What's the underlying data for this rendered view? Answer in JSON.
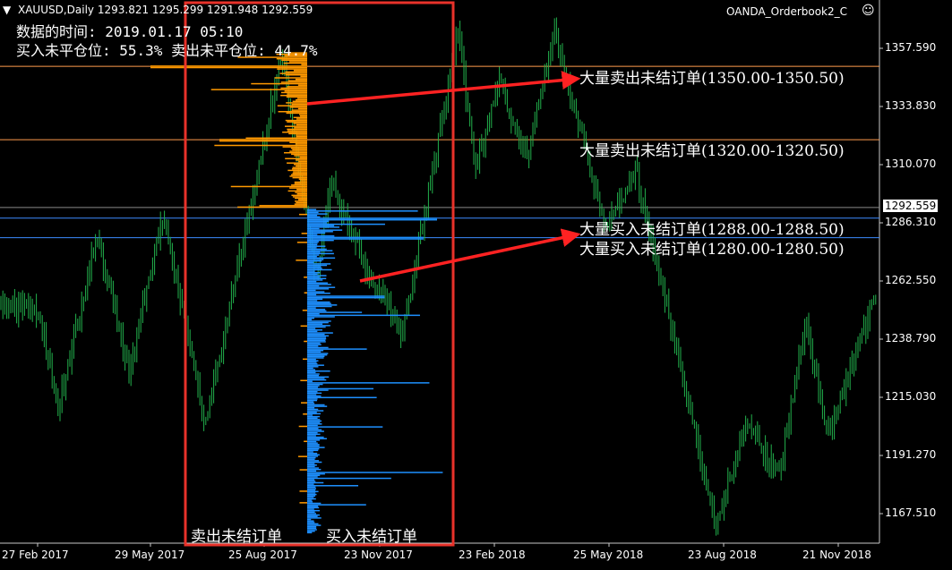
{
  "header": {
    "symbol_line": "XAUUSD,Daily  1293.821 1295.299 1291.948 1292.559",
    "indicator_name": "OANDA_Orderbook2_C",
    "data_time_line": "数据的时间: 2019.01.17 05:10",
    "positions_line": "买入未平仓位: 55.3% 卖出未平仓位: 44.7%"
  },
  "annotations": [
    {
      "text": "大量卖出未结订单(1350.00-1350.50)",
      "price": 1350.25
    },
    {
      "text": "大量卖出未结订单(1320.00-1320.50)",
      "price": 1320.25
    },
    {
      "text": "大量买入未结订单(1288.00-1288.50)",
      "price": 1288.25
    },
    {
      "text": "大量买入未结订单(1280.00-1280.50)",
      "price": 1280.25
    }
  ],
  "bottom_labels": {
    "sell": "卖出未结订单",
    "buy": "买入未结订单"
  },
  "current_price": "1292.559",
  "colors": {
    "background": "#000000",
    "candles": "#22b14c",
    "sell_orders": "#ff9900",
    "buy_orders": "#1e90ff",
    "highlight_box": "#e8322a",
    "arrow": "#ff2222",
    "level_sell": "#ff9d4d",
    "level_buy": "#3c8cff"
  },
  "chart_data": {
    "type": "candlestick",
    "symbol": "XAUUSD",
    "timeframe": "Daily",
    "ohlc_last": {
      "open": 1293.821,
      "high": 1295.299,
      "low": 1291.948,
      "close": 1292.559
    },
    "y_ticks": [
      "1357.590",
      "1333.830",
      "1310.070",
      "1286.310",
      "1262.550",
      "1238.790",
      "1215.030",
      "1191.270",
      "1167.510"
    ],
    "x_ticks": [
      "27 Feb 2017",
      "29 May 2017",
      "25 Aug 2017",
      "23 Nov 2017",
      "23 Feb 2018",
      "25 May 2018",
      "23 Aug 2018",
      "21 Nov 2018"
    ],
    "ylim": [
      1156.0,
      1370.0
    ],
    "price_path": [
      {
        "date": "2017-02-27",
        "price": 1252
      },
      {
        "date": "2017-03-15",
        "price": 1210
      },
      {
        "date": "2017-04-15",
        "price": 1282
      },
      {
        "date": "2017-05-10",
        "price": 1225
      },
      {
        "date": "2017-06-06",
        "price": 1290
      },
      {
        "date": "2017-07-10",
        "price": 1205
      },
      {
        "date": "2017-09-08",
        "price": 1355
      },
      {
        "date": "2017-10-06",
        "price": 1262
      },
      {
        "date": "2017-10-16",
        "price": 1305
      },
      {
        "date": "2017-11-10",
        "price": 1272
      },
      {
        "date": "2017-12-12",
        "price": 1240
      },
      {
        "date": "2018-01-25",
        "price": 1364
      },
      {
        "date": "2018-02-08",
        "price": 1308
      },
      {
        "date": "2018-02-26",
        "price": 1345
      },
      {
        "date": "2018-03-20",
        "price": 1312
      },
      {
        "date": "2018-04-11",
        "price": 1365
      },
      {
        "date": "2018-05-21",
        "price": 1285
      },
      {
        "date": "2018-06-14",
        "price": 1308
      },
      {
        "date": "2018-08-16",
        "price": 1163
      },
      {
        "date": "2018-09-10",
        "price": 1205
      },
      {
        "date": "2018-10-05",
        "price": 1182
      },
      {
        "date": "2018-10-26",
        "price": 1245
      },
      {
        "date": "2018-11-13",
        "price": 1198
      },
      {
        "date": "2018-12-10",
        "price": 1242
      },
      {
        "date": "2019-01-17",
        "price": 1292.559
      }
    ],
    "horizontal_levels": [
      {
        "price": 1350.25,
        "side": "sell"
      },
      {
        "price": 1320.25,
        "side": "sell"
      },
      {
        "price": 1288.25,
        "side": "buy"
      },
      {
        "price": 1280.25,
        "side": "buy"
      }
    ],
    "orderbook_split_price": 1292.559,
    "orderbook": {
      "sell_side_note": "orange bars above current price",
      "buy_side_note": "blue bars below current price"
    }
  }
}
